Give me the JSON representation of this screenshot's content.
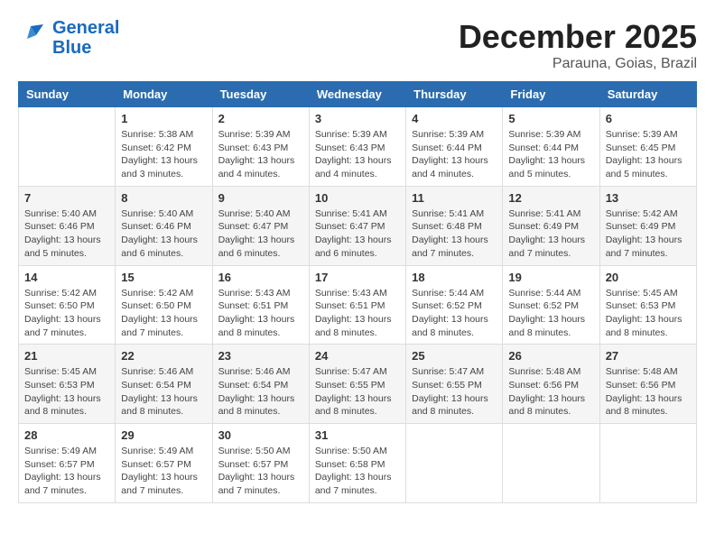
{
  "header": {
    "logo_line1": "General",
    "logo_line2": "Blue",
    "month": "December 2025",
    "location": "Parauna, Goias, Brazil"
  },
  "days_of_week": [
    "Sunday",
    "Monday",
    "Tuesday",
    "Wednesday",
    "Thursday",
    "Friday",
    "Saturday"
  ],
  "weeks": [
    [
      {
        "day": "",
        "sunrise": "",
        "sunset": "",
        "daylight": ""
      },
      {
        "day": "1",
        "sunrise": "Sunrise: 5:38 AM",
        "sunset": "Sunset: 6:42 PM",
        "daylight": "Daylight: 13 hours and 3 minutes."
      },
      {
        "day": "2",
        "sunrise": "Sunrise: 5:39 AM",
        "sunset": "Sunset: 6:43 PM",
        "daylight": "Daylight: 13 hours and 4 minutes."
      },
      {
        "day": "3",
        "sunrise": "Sunrise: 5:39 AM",
        "sunset": "Sunset: 6:43 PM",
        "daylight": "Daylight: 13 hours and 4 minutes."
      },
      {
        "day": "4",
        "sunrise": "Sunrise: 5:39 AM",
        "sunset": "Sunset: 6:44 PM",
        "daylight": "Daylight: 13 hours and 4 minutes."
      },
      {
        "day": "5",
        "sunrise": "Sunrise: 5:39 AM",
        "sunset": "Sunset: 6:44 PM",
        "daylight": "Daylight: 13 hours and 5 minutes."
      },
      {
        "day": "6",
        "sunrise": "Sunrise: 5:39 AM",
        "sunset": "Sunset: 6:45 PM",
        "daylight": "Daylight: 13 hours and 5 minutes."
      }
    ],
    [
      {
        "day": "7",
        "sunrise": "Sunrise: 5:40 AM",
        "sunset": "Sunset: 6:46 PM",
        "daylight": "Daylight: 13 hours and 5 minutes."
      },
      {
        "day": "8",
        "sunrise": "Sunrise: 5:40 AM",
        "sunset": "Sunset: 6:46 PM",
        "daylight": "Daylight: 13 hours and 6 minutes."
      },
      {
        "day": "9",
        "sunrise": "Sunrise: 5:40 AM",
        "sunset": "Sunset: 6:47 PM",
        "daylight": "Daylight: 13 hours and 6 minutes."
      },
      {
        "day": "10",
        "sunrise": "Sunrise: 5:41 AM",
        "sunset": "Sunset: 6:47 PM",
        "daylight": "Daylight: 13 hours and 6 minutes."
      },
      {
        "day": "11",
        "sunrise": "Sunrise: 5:41 AM",
        "sunset": "Sunset: 6:48 PM",
        "daylight": "Daylight: 13 hours and 7 minutes."
      },
      {
        "day": "12",
        "sunrise": "Sunrise: 5:41 AM",
        "sunset": "Sunset: 6:49 PM",
        "daylight": "Daylight: 13 hours and 7 minutes."
      },
      {
        "day": "13",
        "sunrise": "Sunrise: 5:42 AM",
        "sunset": "Sunset: 6:49 PM",
        "daylight": "Daylight: 13 hours and 7 minutes."
      }
    ],
    [
      {
        "day": "14",
        "sunrise": "Sunrise: 5:42 AM",
        "sunset": "Sunset: 6:50 PM",
        "daylight": "Daylight: 13 hours and 7 minutes."
      },
      {
        "day": "15",
        "sunrise": "Sunrise: 5:42 AM",
        "sunset": "Sunset: 6:50 PM",
        "daylight": "Daylight: 13 hours and 7 minutes."
      },
      {
        "day": "16",
        "sunrise": "Sunrise: 5:43 AM",
        "sunset": "Sunset: 6:51 PM",
        "daylight": "Daylight: 13 hours and 8 minutes."
      },
      {
        "day": "17",
        "sunrise": "Sunrise: 5:43 AM",
        "sunset": "Sunset: 6:51 PM",
        "daylight": "Daylight: 13 hours and 8 minutes."
      },
      {
        "day": "18",
        "sunrise": "Sunrise: 5:44 AM",
        "sunset": "Sunset: 6:52 PM",
        "daylight": "Daylight: 13 hours and 8 minutes."
      },
      {
        "day": "19",
        "sunrise": "Sunrise: 5:44 AM",
        "sunset": "Sunset: 6:52 PM",
        "daylight": "Daylight: 13 hours and 8 minutes."
      },
      {
        "day": "20",
        "sunrise": "Sunrise: 5:45 AM",
        "sunset": "Sunset: 6:53 PM",
        "daylight": "Daylight: 13 hours and 8 minutes."
      }
    ],
    [
      {
        "day": "21",
        "sunrise": "Sunrise: 5:45 AM",
        "sunset": "Sunset: 6:53 PM",
        "daylight": "Daylight: 13 hours and 8 minutes."
      },
      {
        "day": "22",
        "sunrise": "Sunrise: 5:46 AM",
        "sunset": "Sunset: 6:54 PM",
        "daylight": "Daylight: 13 hours and 8 minutes."
      },
      {
        "day": "23",
        "sunrise": "Sunrise: 5:46 AM",
        "sunset": "Sunset: 6:54 PM",
        "daylight": "Daylight: 13 hours and 8 minutes."
      },
      {
        "day": "24",
        "sunrise": "Sunrise: 5:47 AM",
        "sunset": "Sunset: 6:55 PM",
        "daylight": "Daylight: 13 hours and 8 minutes."
      },
      {
        "day": "25",
        "sunrise": "Sunrise: 5:47 AM",
        "sunset": "Sunset: 6:55 PM",
        "daylight": "Daylight: 13 hours and 8 minutes."
      },
      {
        "day": "26",
        "sunrise": "Sunrise: 5:48 AM",
        "sunset": "Sunset: 6:56 PM",
        "daylight": "Daylight: 13 hours and 8 minutes."
      },
      {
        "day": "27",
        "sunrise": "Sunrise: 5:48 AM",
        "sunset": "Sunset: 6:56 PM",
        "daylight": "Daylight: 13 hours and 8 minutes."
      }
    ],
    [
      {
        "day": "28",
        "sunrise": "Sunrise: 5:49 AM",
        "sunset": "Sunset: 6:57 PM",
        "daylight": "Daylight: 13 hours and 7 minutes."
      },
      {
        "day": "29",
        "sunrise": "Sunrise: 5:49 AM",
        "sunset": "Sunset: 6:57 PM",
        "daylight": "Daylight: 13 hours and 7 minutes."
      },
      {
        "day": "30",
        "sunrise": "Sunrise: 5:50 AM",
        "sunset": "Sunset: 6:57 PM",
        "daylight": "Daylight: 13 hours and 7 minutes."
      },
      {
        "day": "31",
        "sunrise": "Sunrise: 5:50 AM",
        "sunset": "Sunset: 6:58 PM",
        "daylight": "Daylight: 13 hours and 7 minutes."
      },
      {
        "day": "",
        "sunrise": "",
        "sunset": "",
        "daylight": ""
      },
      {
        "day": "",
        "sunrise": "",
        "sunset": "",
        "daylight": ""
      },
      {
        "day": "",
        "sunrise": "",
        "sunset": "",
        "daylight": ""
      }
    ]
  ]
}
